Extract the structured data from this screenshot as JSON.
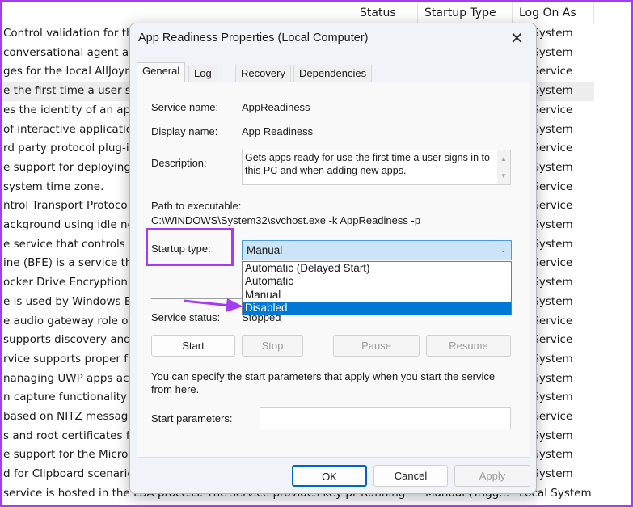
{
  "background_list": {
    "columns": [
      "Status",
      "Startup Type",
      "Log On As"
    ],
    "rows": [
      {
        "description": "Control validation for th",
        "log_on_as": "al System"
      },
      {
        "description": "conversational agent ap",
        "log_on_as": "al System"
      },
      {
        "description": "ges for the local AllJoyn c",
        "log_on_as": "al Service"
      },
      {
        "description": "e the first time a user sig",
        "log_on_as": "al System",
        "selected": true
      },
      {
        "description": "es the identity of an appl",
        "log_on_as": "al Service"
      },
      {
        "description": "of interactive applicatio",
        "log_on_as": "al System"
      },
      {
        "description": "rd party protocol plug-ir",
        "log_on_as": "al Service"
      },
      {
        "description": "e support for deploying S",
        "log_on_as": "al System"
      },
      {
        "description": "system time zone.",
        "log_on_as": "al Service"
      },
      {
        "description": "ntrol Transport Protocol",
        "log_on_as": "al Service"
      },
      {
        "description": "ackground using idle net",
        "log_on_as": "al System"
      },
      {
        "description": "e service that controls wh",
        "log_on_as": "al System"
      },
      {
        "description": "ine (BFE) is a service that",
        "log_on_as": "al Service"
      },
      {
        "description": "ocker Drive Encryption se",
        "log_on_as": "al System"
      },
      {
        "description": "e is used by Windows Ba",
        "log_on_as": "al System"
      },
      {
        "description": "e audio gateway role of th",
        "log_on_as": "al Service"
      },
      {
        "description": "supports discovery and a",
        "log_on_as": "al Service"
      },
      {
        "description": "rvice supports proper fur",
        "log_on_as": "al System"
      },
      {
        "description": "nanaging UWP apps acce",
        "log_on_as": "al System"
      },
      {
        "description": "n capture functionality f",
        "log_on_as": "al System"
      },
      {
        "description": "based on NITZ messages",
        "log_on_as": "al Service"
      },
      {
        "description": "s and root certificates fro",
        "log_on_as": "al System"
      },
      {
        "description": "e support for the Microso",
        "log_on_as": "al System"
      },
      {
        "description": "d for Clipboard scenario",
        "log_on_as": "al System"
      },
      {
        "description": "service is hosted in the LSA process. The service provides key pr",
        "status": "Running",
        "startup_type": "Manual (Trigg...",
        "log_on_as": "Local System"
      }
    ]
  },
  "dialog": {
    "title": "App Readiness Properties (Local Computer)",
    "tabs": [
      "General",
      "Log On",
      "Recovery",
      "Dependencies"
    ],
    "active_tab": "General",
    "service_name_label": "Service name:",
    "service_name": "AppReadiness",
    "display_name_label": "Display name:",
    "display_name": "App Readiness",
    "description_label": "Description:",
    "description": "Gets apps ready for use the first time a user signs in to this PC and when adding new apps.",
    "path_label": "Path to executable:",
    "path": "C:\\WINDOWS\\System32\\svchost.exe -k AppReadiness -p",
    "startup_type_label": "Startup type:",
    "startup_type": "Manual",
    "startup_options": [
      "Automatic (Delayed Start)",
      "Automatic",
      "Manual",
      "Disabled"
    ],
    "highlighted_option": "Disabled",
    "service_status_label": "Service status:",
    "service_status": "Stopped",
    "buttons": {
      "start": "Start",
      "stop": "Stop",
      "pause": "Pause",
      "resume": "Resume"
    },
    "hint": "You can specify the start parameters that apply when you start the service from here.",
    "start_params_label": "Start parameters:",
    "start_params_value": "",
    "footer": {
      "ok": "OK",
      "cancel": "Cancel",
      "apply": "Apply"
    }
  },
  "colors": {
    "annotation": "#a43cf0",
    "selection": "#0078d4"
  }
}
